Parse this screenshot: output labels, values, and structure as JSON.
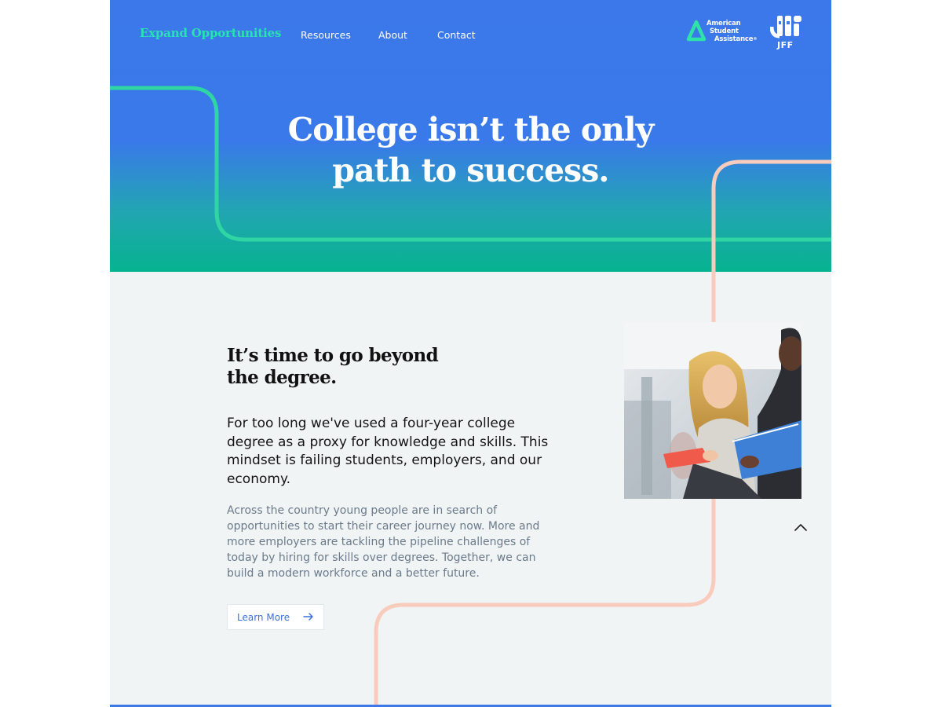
{
  "nav": {
    "brand": "Expand Opportunities",
    "links": [
      {
        "label": "Resources"
      },
      {
        "label": "About"
      },
      {
        "label": "Contact"
      }
    ]
  },
  "logos": {
    "asa_line1": "American",
    "asa_line2": "Student",
    "asa_line3": "Assistance",
    "asa_mark": "®",
    "jff": "JFF"
  },
  "hero": {
    "title_line1": "College isn’t the only",
    "title_line2": "path to success."
  },
  "section": {
    "heading_line1": "It’s time to go beyond",
    "heading_line2": "the degree.",
    "lead": "For too long we've used a four-year college degree as a proxy for knowledge and skills. This mindset is failing students, employers, and our economy.",
    "body": "Across the country young people are in search of opportunities to start their career journey now. More and more employers are tackling the pipeline challenges of today by hiring for skills over degrees. Together, we can build a modern workforce and a better future.",
    "button_label": "Learn More"
  },
  "icons": {
    "button_arrow": "arrow-right-icon",
    "scroll_top": "chevron-up-icon"
  },
  "colors": {
    "hero_top": "#3c78ea",
    "hero_bottom": "#06b38f",
    "brand": "#28e3b1",
    "path_green": "#2fd6a4",
    "path_peach": "#f8cbbc",
    "link_blue": "#3b70dc",
    "background": "#f1f4f5"
  }
}
